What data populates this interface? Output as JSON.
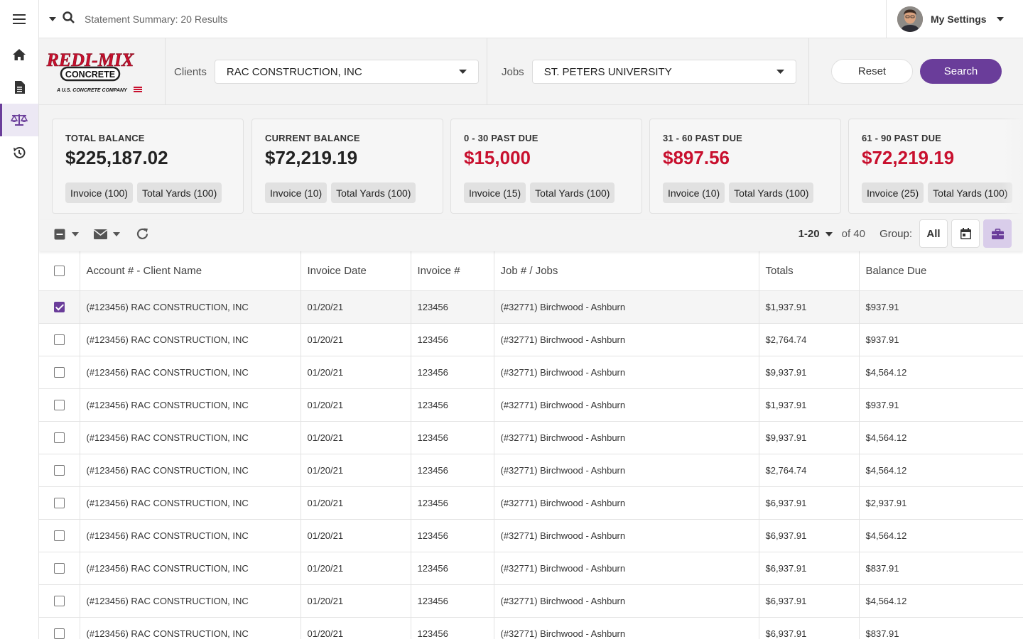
{
  "topbar": {
    "title": "Statement Summary: 20 Results",
    "settings_label": "My Settings"
  },
  "nav": {
    "items": [
      {
        "icon": "menu-icon"
      },
      {
        "icon": "home-icon"
      },
      {
        "icon": "document-icon"
      },
      {
        "icon": "scale-icon",
        "active": true
      },
      {
        "icon": "history-icon"
      }
    ]
  },
  "logo": {
    "line1": "REDI-MIX",
    "line2": "CONCRETE",
    "line3": "A U.S. CONCRETE COMPANY"
  },
  "filters": {
    "clients_label": "Clients",
    "clients_value": "RAC CONSTRUCTION, INC",
    "jobs_label": "Jobs",
    "jobs_value": "ST. PETERS UNIVERSITY",
    "reset_label": "Reset",
    "search_label": "Search"
  },
  "cards": [
    {
      "label": "TOTAL BALANCE",
      "value": "$225,187.02",
      "red": false,
      "chips": [
        "Invoice (100)",
        "Total Yards (100)"
      ]
    },
    {
      "label": "CURRENT BALANCE",
      "value": "$72,219.19",
      "red": false,
      "chips": [
        "Invoice (10)",
        "Total Yards (100)"
      ]
    },
    {
      "label": "0 - 30 PAST DUE",
      "value": "$15,000",
      "red": true,
      "chips": [
        "Invoice (15)",
        "Total Yards (100)"
      ]
    },
    {
      "label": "31 - 60 PAST DUE",
      "value": "$897.56",
      "red": true,
      "chips": [
        "Invoice (10)",
        "Total Yards (100)"
      ]
    },
    {
      "label": "61 - 90 PAST DUE",
      "value": "$72,219.19",
      "red": true,
      "chips": [
        "Invoice (25)",
        "Total Yards (100)"
      ]
    }
  ],
  "toolbar": {
    "page_range": "1-20",
    "page_of": "of 40",
    "group_label": "Group:",
    "group_all": "All"
  },
  "table": {
    "headers": [
      "Account # - Client Name",
      "Invoice Date",
      "Invoice #",
      "Job # / Jobs",
      "Totals",
      "Balance Due"
    ],
    "rows": [
      {
        "checked": true,
        "cells": [
          "(#123456) RAC CONSTRUCTION, INC",
          "01/20/21",
          "123456",
          "(#32771) Birchwood - Ashburn",
          "$1,937.91",
          "$937.91"
        ]
      },
      {
        "checked": false,
        "cells": [
          "(#123456) RAC CONSTRUCTION, INC",
          "01/20/21",
          "123456",
          "(#32771) Birchwood - Ashburn",
          "$2,764.74",
          "$937.91"
        ]
      },
      {
        "checked": false,
        "cells": [
          "(#123456) RAC CONSTRUCTION, INC",
          "01/20/21",
          "123456",
          "(#32771) Birchwood - Ashburn",
          "$9,937.91",
          "$4,564.12"
        ]
      },
      {
        "checked": false,
        "cells": [
          "(#123456) RAC CONSTRUCTION, INC",
          "01/20/21",
          "123456",
          "(#32771) Birchwood - Ashburn",
          "$1,937.91",
          "$937.91"
        ]
      },
      {
        "checked": false,
        "cells": [
          "(#123456) RAC CONSTRUCTION, INC",
          "01/20/21",
          "123456",
          "(#32771) Birchwood - Ashburn",
          "$9,937.91",
          "$4,564.12"
        ]
      },
      {
        "checked": false,
        "cells": [
          "(#123456) RAC CONSTRUCTION, INC",
          "01/20/21",
          "123456",
          "(#32771) Birchwood - Ashburn",
          "$2,764.74",
          "$4,564.12"
        ]
      },
      {
        "checked": false,
        "cells": [
          "(#123456) RAC CONSTRUCTION, INC",
          "01/20/21",
          "123456",
          "(#32771) Birchwood - Ashburn",
          "$6,937.91",
          "$2,937.91"
        ]
      },
      {
        "checked": false,
        "cells": [
          "(#123456) RAC CONSTRUCTION, INC",
          "01/20/21",
          "123456",
          "(#32771) Birchwood - Ashburn",
          "$6,937.91",
          "$4,564.12"
        ]
      },
      {
        "checked": false,
        "cells": [
          "(#123456) RAC CONSTRUCTION, INC",
          "01/20/21",
          "123456",
          "(#32771) Birchwood - Ashburn",
          "$6,937.91",
          "$837.91"
        ]
      },
      {
        "checked": false,
        "cells": [
          "(#123456) RAC CONSTRUCTION, INC",
          "01/20/21",
          "123456",
          "(#32771) Birchwood - Ashburn",
          "$6,937.91",
          "$4,564.12"
        ]
      },
      {
        "checked": false,
        "cells": [
          "(#123456) RAC CONSTRUCTION, INC",
          "01/20/21",
          "123456",
          "(#32771) Birchwood - Ashburn",
          "$6,937.91",
          "$837.91"
        ]
      }
    ]
  },
  "colors": {
    "accent": "#6a3d9a",
    "past_due_red": "#c8102e",
    "logo_red": "#c8102e"
  }
}
